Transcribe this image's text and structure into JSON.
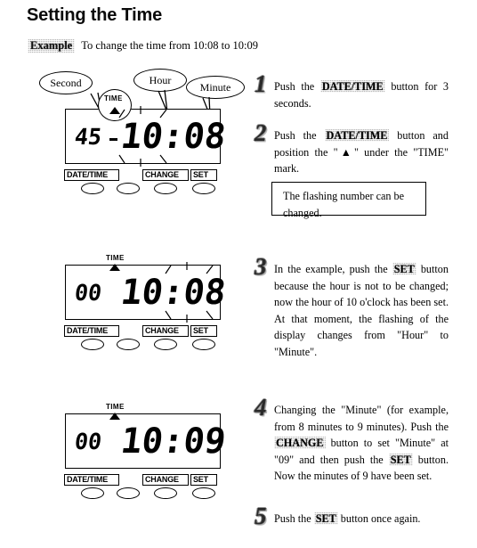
{
  "page": {
    "title": "Setting the Time",
    "example_badge": "Example",
    "example_text": "To change the time from 10:08 to 10:09"
  },
  "callouts": [
    {
      "label": "Second"
    },
    {
      "label": "Hour"
    },
    {
      "label": "Minute"
    }
  ],
  "devices": [
    {
      "id": "device-1",
      "time_mark_label": "TIME",
      "seconds": "45",
      "time": "10:08",
      "flashing": "hour",
      "buttons": [
        {
          "label": "DATE/TIME"
        },
        {
          "label": ""
        },
        {
          "label": "CHANGE"
        },
        {
          "label": "SET"
        }
      ]
    },
    {
      "id": "device-2",
      "time_mark_label": "TIME",
      "seconds": "00",
      "time": "10:08",
      "flashing": "minute",
      "buttons": [
        {
          "label": "DATE/TIME"
        },
        {
          "label": ""
        },
        {
          "label": "CHANGE"
        },
        {
          "label": "SET"
        }
      ]
    },
    {
      "id": "device-3",
      "time_mark_label": "TIME",
      "seconds": "00",
      "time": "10:09",
      "flashing": "none",
      "buttons": [
        {
          "label": "DATE/TIME"
        },
        {
          "label": ""
        },
        {
          "label": "CHANGE"
        },
        {
          "label": "SET"
        }
      ]
    }
  ],
  "steps": [
    {
      "number": "1",
      "parts": [
        {
          "t": "Push the ",
          "k": false
        },
        {
          "t": "DATE/TIME",
          "k": true
        },
        {
          "t": " button for 3 seconds.",
          "k": false
        }
      ]
    },
    {
      "number": "2",
      "parts": [
        {
          "t": "Push the ",
          "k": false
        },
        {
          "t": "DATE/TIME",
          "k": true
        },
        {
          "t": " button and position the \"▲\" under the \"TIME\" mark.",
          "k": false
        }
      ]
    },
    {
      "number": "3",
      "parts": [
        {
          "t": "In the example, push the ",
          "k": false
        },
        {
          "t": "SET",
          "k": true
        },
        {
          "t": " button because the hour is not to be changed; now the hour of 10 o'clock has been set. At that moment, the flashing of the display changes from \"Hour\" to \"Minute\".",
          "k": false
        }
      ]
    },
    {
      "number": "4",
      "parts": [
        {
          "t": "Changing the \"Minute\" (for example, from 8 minutes to 9 minutes). Push the ",
          "k": false
        },
        {
          "t": "CHANGE",
          "k": true
        },
        {
          "t": " button to set \"Minute\" at \"09\" and then push the ",
          "k": false
        },
        {
          "t": "SET",
          "k": true
        },
        {
          "t": " button. Now the minutes of 9 have been set.",
          "k": false
        }
      ]
    },
    {
      "number": "5",
      "parts": [
        {
          "t": "Push the ",
          "k": false
        },
        {
          "t": "SET",
          "k": true
        },
        {
          "t": " button once again.",
          "k": false
        }
      ]
    }
  ],
  "note_box": {
    "text": "The flashing number can be changed."
  }
}
